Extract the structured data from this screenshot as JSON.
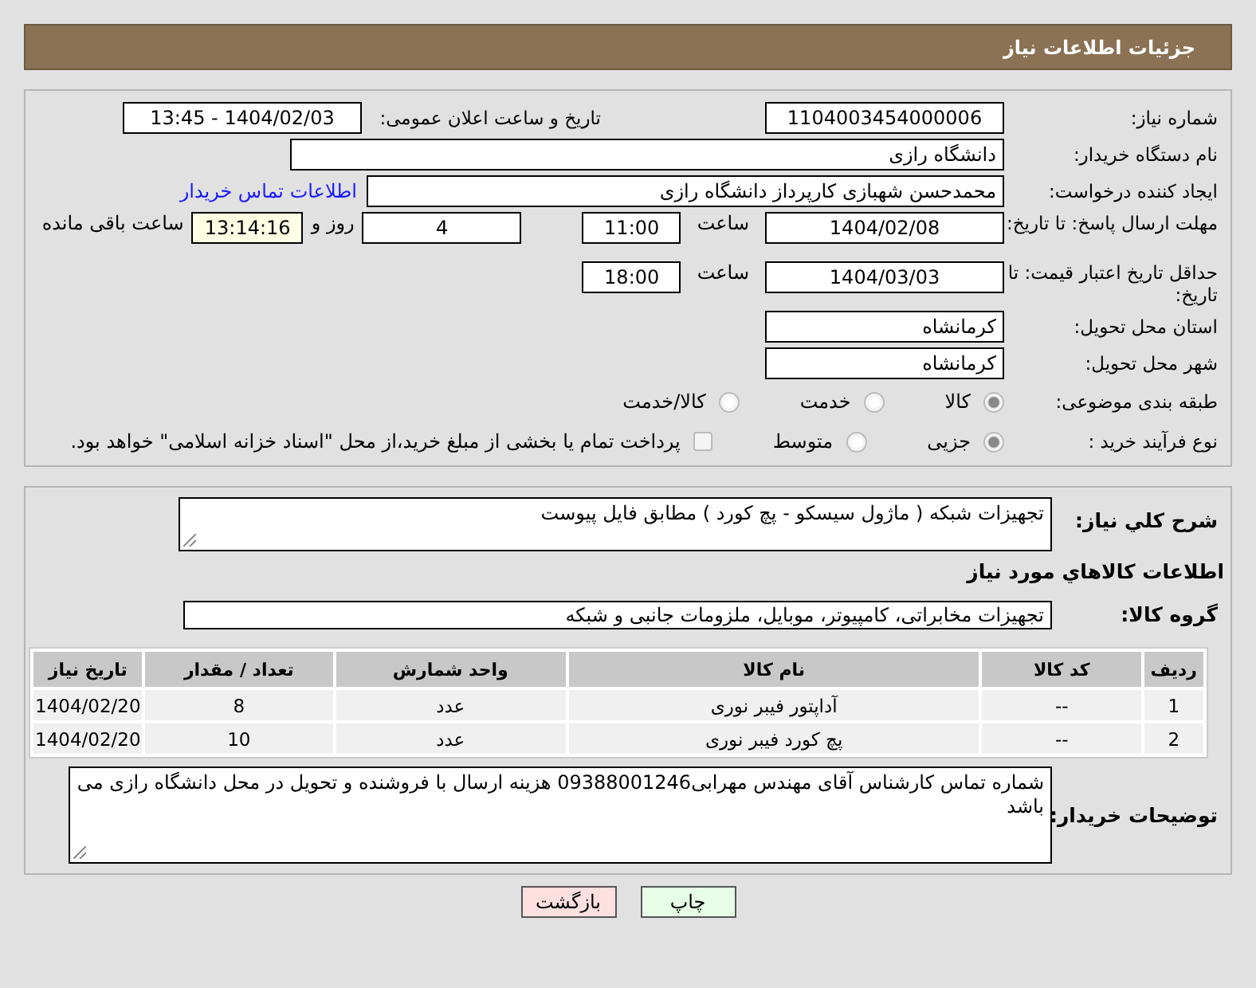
{
  "header": {
    "title": "جزئیات اطلاعات نیاز"
  },
  "need_number": {
    "label": "شماره نیاز:",
    "value": "1104003454000006"
  },
  "announce": {
    "label": "تاریخ و ساعت اعلان عمومی:",
    "value": "1404/02/03 - 13:45"
  },
  "buyer_org": {
    "label": "نام دستگاه خریدار:",
    "value": "دانشگاه رازی"
  },
  "creator": {
    "label": "ایجاد کننده درخواست:",
    "value": "محمدحسن شهبازی کارپرداز دانشگاه رازی",
    "link": "اطلاعات تماس خریدار"
  },
  "reply_deadline": {
    "label": "مهلت ارسال پاسخ: تا تاریخ:",
    "date": "1404/02/08",
    "time_label": "ساعت",
    "time": "11:00",
    "days": "4",
    "days_label": "روز و",
    "remaining": "13:14:16",
    "remaining_label": "ساعت باقی مانده"
  },
  "price_validity": {
    "label": "حداقل تاریخ اعتبار قیمت: تا تاریخ:",
    "date": "1404/03/03",
    "time_label": "ساعت",
    "time": "18:00"
  },
  "province": {
    "label": "استان محل تحویل:",
    "value": "کرمانشاه"
  },
  "city": {
    "label": "شهر محل تحویل:",
    "value": "کرمانشاه"
  },
  "category": {
    "label": "طبقه بندی موضوعی:",
    "options": [
      {
        "label": "کالا",
        "selected": true
      },
      {
        "label": "خدمت",
        "selected": false
      },
      {
        "label": "کالا/خدمت",
        "selected": false
      }
    ]
  },
  "process": {
    "label": "نوع فرآیند خرید :",
    "options": [
      {
        "label": "جزیی",
        "selected": true
      },
      {
        "label": "متوسط",
        "selected": false
      }
    ],
    "treasury": {
      "checked": false,
      "text": "پرداخت تمام یا بخشی از مبلغ خرید،از محل \"اسناد خزانه اسلامی\" خواهد بود."
    }
  },
  "description": {
    "label": "شرح کلي نياز:",
    "value": "تجهیزات شبکه ( ماژول سیسکو - پچ کورد ) مطابق فایل پیوست"
  },
  "goods_heading": "اطلاعات کالاهاي مورد نياز",
  "goods_group": {
    "label": "گروه کالا:",
    "value": "تجهیزات مخابراتی، کامپیوتر، موبایل، ملزومات جانبی و شبکه"
  },
  "table": {
    "columns": [
      "ردیف",
      "کد کالا",
      "نام کالا",
      "واحد شمارش",
      "تعداد / مقدار",
      "تاریخ نیاز"
    ],
    "rows": [
      [
        "1",
        "--",
        "آداپتور فیبر نوری",
        "عدد",
        "8",
        "1404/02/20"
      ],
      [
        "2",
        "--",
        "پچ کورد فیبر نوری",
        "عدد",
        "10",
        "1404/02/20"
      ]
    ]
  },
  "buyer_notes": {
    "label": "توضیحات خریدار:",
    "value": "شماره تماس کارشناس آقای مهندس مهرابی09388001246 هزینه ارسال با فروشنده و تحویل در محل دانشگاه رازی می باشد"
  },
  "buttons": [
    {
      "kind": "print",
      "label": "چاپ"
    },
    {
      "kind": "back",
      "label": "بازگشت"
    }
  ]
}
